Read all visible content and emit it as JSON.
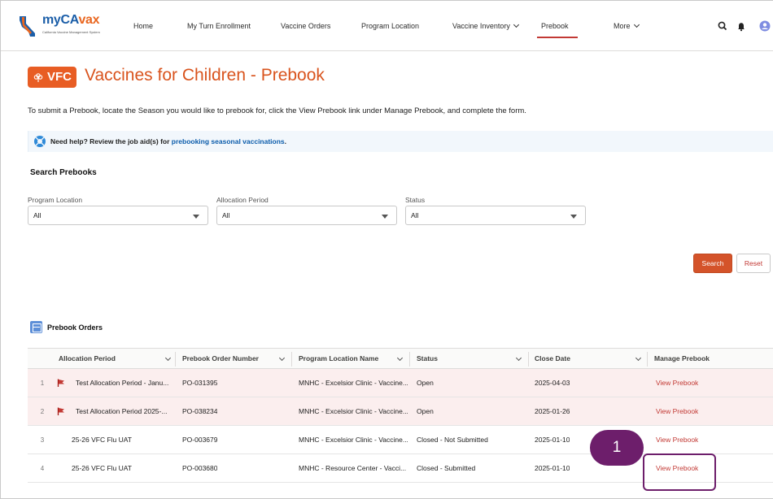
{
  "app": {
    "logo_text_a": "myCA",
    "logo_text_b": "vax",
    "logo_subtitle": "California Vaccine Management System"
  },
  "nav": {
    "items": [
      {
        "label": "Home"
      },
      {
        "label": "My Turn Enrollment"
      },
      {
        "label": "Vaccine Orders"
      },
      {
        "label": "Program Location"
      },
      {
        "label": "Vaccine Inventory"
      },
      {
        "label": "Prebook"
      },
      {
        "label": "More"
      }
    ],
    "active": "Prebook"
  },
  "page": {
    "badge": "VFC",
    "title": "Vaccines for Children - Prebook",
    "intro": "To submit a Prebook, locate the Season you would like to prebook for, click the View Prebook link under Manage Prebook, and complete the form."
  },
  "help": {
    "text": "Need help? Review the job aid(s) for ",
    "link": "prebooking seasonal vaccinations",
    "suffix": "."
  },
  "search": {
    "title": "Search Prebooks",
    "fields": [
      {
        "label": "Program Location",
        "value": "All"
      },
      {
        "label": "Allocation Period",
        "value": "All"
      },
      {
        "label": "Status",
        "value": "All"
      }
    ],
    "search_label": "Search",
    "reset_label": "Reset"
  },
  "table": {
    "title": "Prebook Orders",
    "columns": [
      "Allocation Period",
      "Prebook Order Number",
      "Program Location Name",
      "Status",
      "Close Date",
      "Manage Prebook"
    ],
    "rows": [
      {
        "num": "1",
        "flag": true,
        "period": "Test Allocation Period - Janu...",
        "order": "PO-031395",
        "location": "MNHC - Excelsior Clinic - Vaccine...",
        "status": "Open",
        "close": "2025-04-03",
        "action": "View Prebook"
      },
      {
        "num": "2",
        "flag": true,
        "period": "Test Allocation Period 2025-...",
        "order": "PO-038234",
        "location": "MNHC - Excelsior Clinic - Vaccine...",
        "status": "Open",
        "close": "2025-01-26",
        "action": "View Prebook"
      },
      {
        "num": "3",
        "flag": false,
        "period": "25-26 VFC Flu UAT",
        "order": "PO-003679",
        "location": "MNHC - Excelsior Clinic - Vaccine...",
        "status": "Closed - Not Submitted",
        "close": "2025-01-10",
        "action": "View Prebook"
      },
      {
        "num": "4",
        "flag": false,
        "period": "25-26 VFC Flu UAT",
        "order": "PO-003680",
        "location": "MNHC - Resource Center - Vacci...",
        "status": "Closed - Submitted",
        "close": "2025-01-10",
        "action": "View Prebook"
      }
    ]
  },
  "callout": {
    "number": "1"
  },
  "colors": {
    "brand_orange": "#e85d24",
    "title_orange": "#d9541e",
    "link_red": "#c23934",
    "callout_purple": "#6d1e6b",
    "flag_row_bg": "#fbeeee"
  }
}
